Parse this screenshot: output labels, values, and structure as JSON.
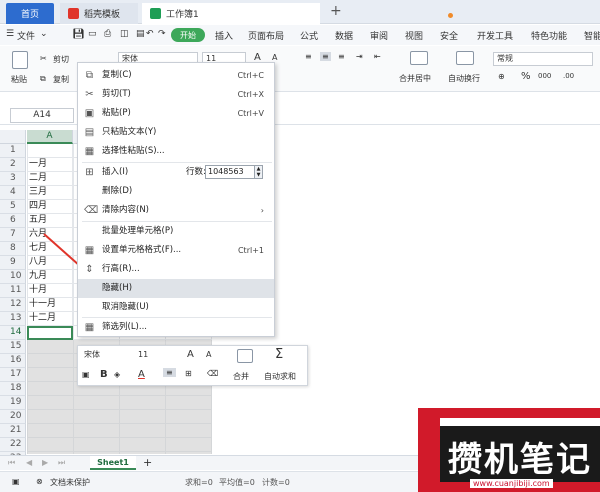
{
  "tabs": {
    "home": "首页",
    "templates": "稻壳模板",
    "workbook": "工作簿1"
  },
  "menubar": {
    "file": "文件",
    "start": "开始",
    "items": [
      "插入",
      "页面布局",
      "公式",
      "数据",
      "审阅",
      "视图",
      "安全",
      "开发工具",
      "特色功能",
      "智能"
    ]
  },
  "ribbon": {
    "paste": "粘贴",
    "cut": "剪切",
    "copy": "复制",
    "font": "宋体",
    "size": "11",
    "number_format": "常规",
    "merge_center": "合并居中",
    "wrap": "自动换行",
    "percent": "%",
    "thousands": "000"
  },
  "namebox": "A14",
  "columns": [
    "A"
  ],
  "rows": [
    "1",
    "2",
    "3",
    "4",
    "5",
    "6",
    "7",
    "8",
    "9",
    "10",
    "11",
    "12",
    "13",
    "14",
    "15",
    "16",
    "17",
    "18",
    "19",
    "20",
    "21",
    "22",
    "23"
  ],
  "cells_A": [
    "",
    "一月",
    "二月",
    "三月",
    "四月",
    "五月",
    "六月",
    "七月",
    "八月",
    "九月",
    "十月",
    "十一月",
    "十二月"
  ],
  "context_menu": {
    "copy": {
      "label": "复制(C)",
      "shortcut": "Ctrl+C"
    },
    "cut": {
      "label": "剪切(T)",
      "shortcut": "Ctrl+X"
    },
    "paste": {
      "label": "粘贴(P)",
      "shortcut": "Ctrl+V"
    },
    "paste_text": "只粘贴文本(Y)",
    "paste_special": "选择性粘贴(S)...",
    "insert": "插入(I)",
    "rows_label": "行数:",
    "rows_value": "1048563",
    "delete": "删除(D)",
    "clear": "清除内容(N)",
    "batch": "批量处理单元格(P)",
    "format_cells": {
      "label": "设置单元格格式(F)...",
      "shortcut": "Ctrl+1"
    },
    "row_height": "行高(R)...",
    "hide": "隐藏(H)",
    "unhide": "取消隐藏(U)",
    "filter_col": "筛选列(L)..."
  },
  "mini_toolbar": {
    "font": "宋体",
    "size": "11",
    "bold": "B",
    "merge": "合并",
    "autosum": "自动求和"
  },
  "sheet": {
    "name": "Sheet1",
    "add": "+"
  },
  "status": {
    "protect": "文档未保护",
    "sum": "求和=0",
    "avg": "平均值=0",
    "count": "计数=0"
  },
  "watermark": {
    "text": "攒机笔记",
    "url": "www.cuanjibiji.com"
  }
}
